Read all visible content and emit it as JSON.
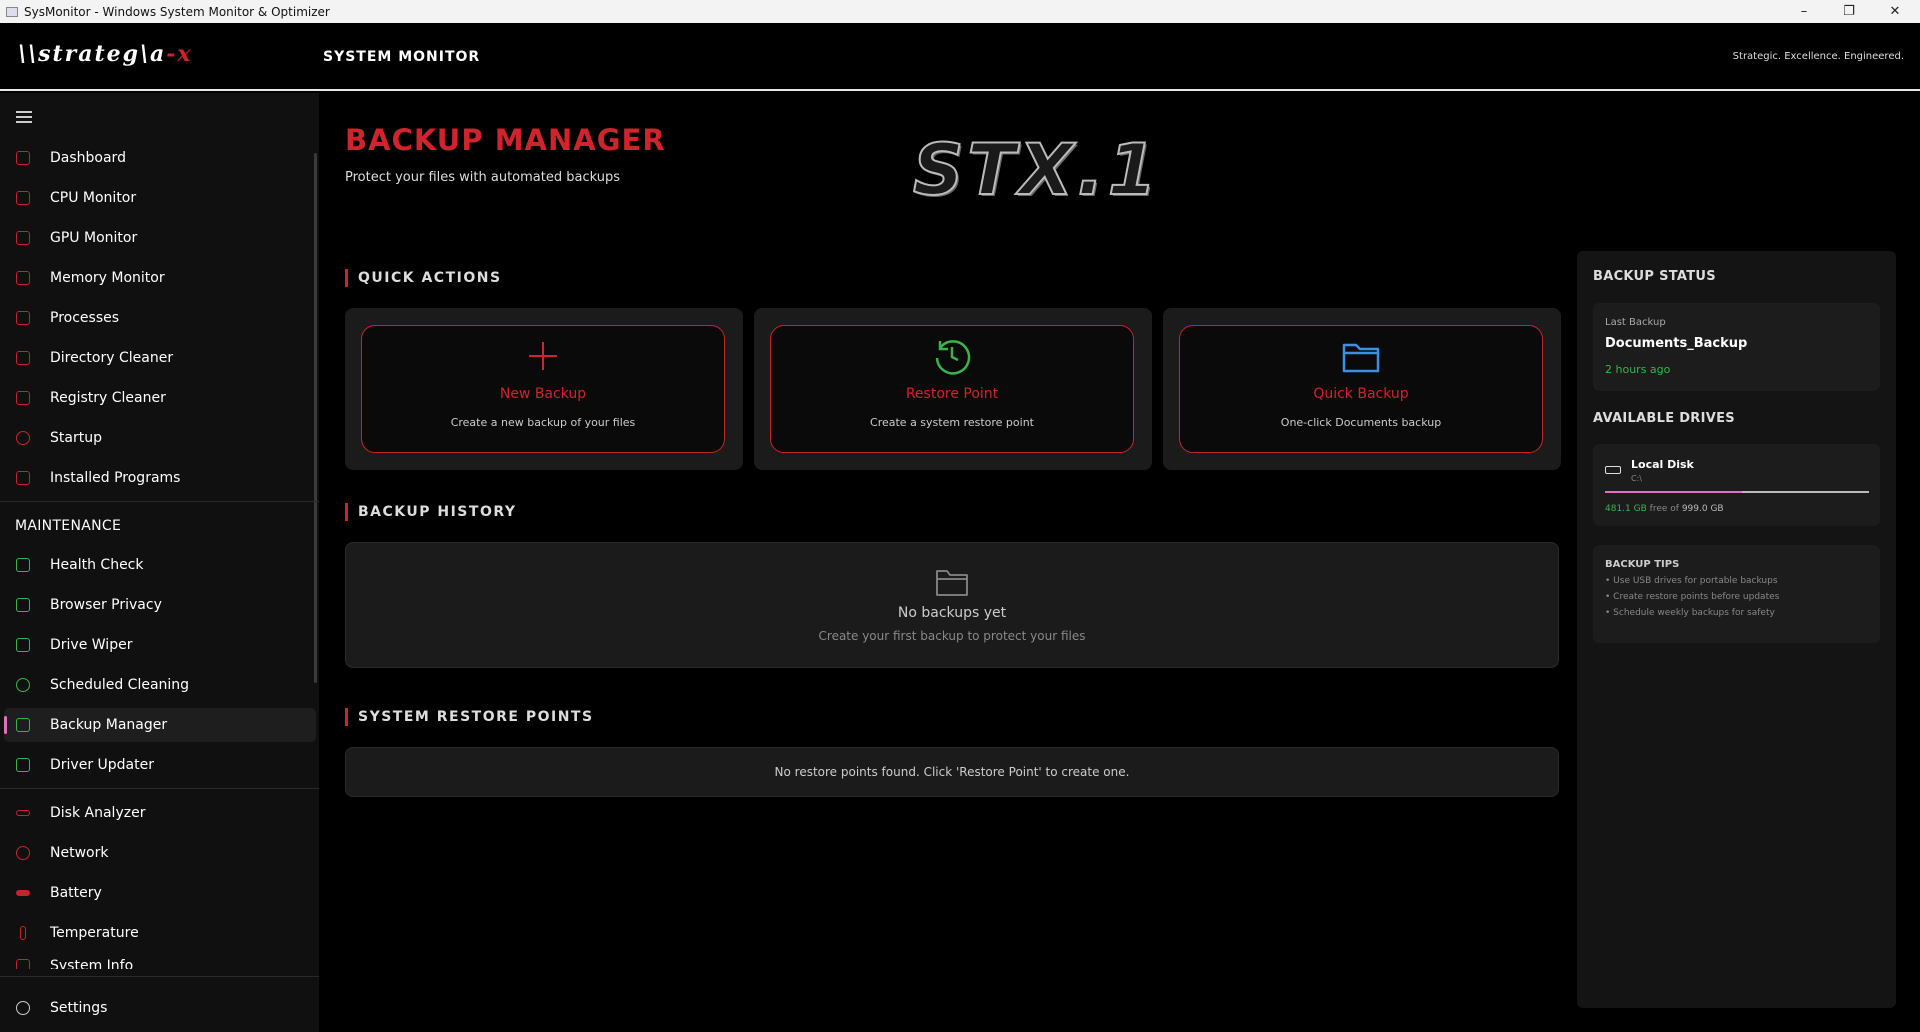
{
  "window": {
    "title": "SysMonitor - Windows System Monitor & Optimizer"
  },
  "header": {
    "logo_text": "\\\\strateg\\a-x",
    "app_title": "SYSTEM MONITOR",
    "tagline": "Strategic. Excellence. Engineered."
  },
  "sidebar": {
    "items": [
      {
        "label": "Dashboard"
      },
      {
        "label": "CPU Monitor"
      },
      {
        "label": "GPU Monitor"
      },
      {
        "label": "Memory Monitor"
      },
      {
        "label": "Processes"
      },
      {
        "label": "Directory Cleaner"
      },
      {
        "label": "Registry Cleaner"
      },
      {
        "label": "Startup"
      },
      {
        "label": "Installed Programs"
      }
    ],
    "maintenance_title": "MAINTENANCE",
    "maintenance_items": [
      {
        "label": "Health Check"
      },
      {
        "label": "Browser Privacy"
      },
      {
        "label": "Drive Wiper"
      },
      {
        "label": "Scheduled Cleaning"
      },
      {
        "label": "Backup Manager"
      },
      {
        "label": "Driver Updater"
      }
    ],
    "tool_items": [
      {
        "label": "Disk Analyzer"
      },
      {
        "label": "Network"
      },
      {
        "label": "Battery"
      },
      {
        "label": "Temperature"
      },
      {
        "label": "System Info"
      }
    ],
    "settings_label": "Settings",
    "active": "Backup Manager"
  },
  "page": {
    "title": "BACKUP MANAGER",
    "subtitle": "Protect your files with automated backups",
    "banner": "STX.1"
  },
  "quick_actions": {
    "title": "QUICK ACTIONS",
    "cards": [
      {
        "label": "New Backup",
        "desc": "Create a new backup of your files",
        "icon": "plus-icon"
      },
      {
        "label": "Restore Point",
        "desc": "Create a system restore point",
        "icon": "history-icon"
      },
      {
        "label": "Quick Backup",
        "desc": "One-click Documents backup",
        "icon": "folder-icon"
      }
    ]
  },
  "history": {
    "title": "BACKUP HISTORY",
    "empty_title": "No backups yet",
    "empty_desc": "Create your first backup to protect your files"
  },
  "restore_points": {
    "title": "SYSTEM RESTORE POINTS",
    "empty_text": "No restore points found. Click 'Restore Point' to create one."
  },
  "status": {
    "title": "BACKUP STATUS",
    "last_label": "Last Backup",
    "last_name": "Documents_Backup",
    "last_time": "2 hours ago",
    "drives_title": "AVAILABLE DRIVES",
    "drive": {
      "name": "Local Disk",
      "path": "C:\\",
      "free": "481.1 GB",
      "free_of": "free of",
      "total": "999.0 GB",
      "used_fraction": 0.52
    },
    "tips_title": "BACKUP TIPS",
    "tips": [
      "• Use USB drives for portable backups",
      "• Create restore points before updates",
      "• Schedule weekly backups for safety"
    ]
  },
  "colors": {
    "accent": "#d0242c",
    "green": "#3bb34a",
    "blue": "#3a8fe8",
    "highlight": "#e070c0"
  }
}
